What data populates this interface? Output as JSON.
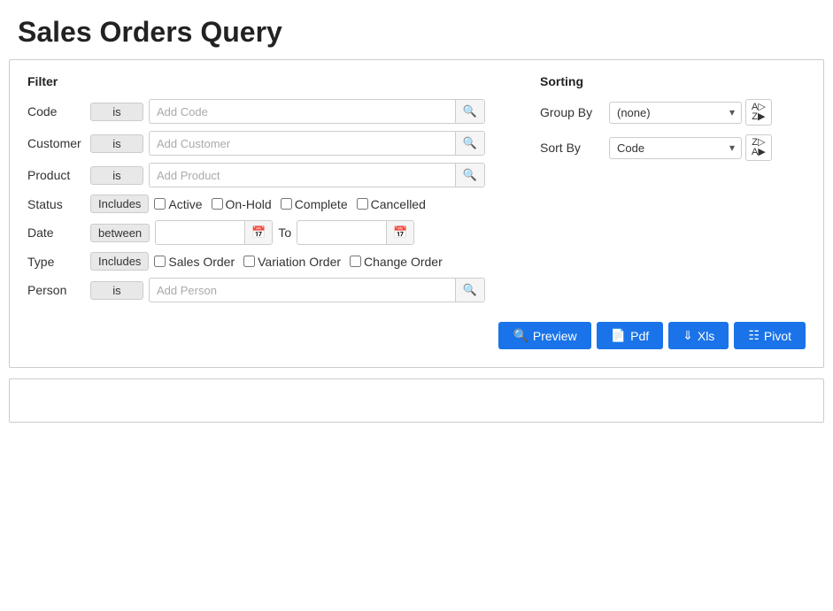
{
  "page": {
    "title": "Sales Orders Query"
  },
  "filter": {
    "heading": "Filter",
    "rows": [
      {
        "label": "Code",
        "badge": "is",
        "input_placeholder": "Add Code",
        "type": "text"
      },
      {
        "label": "Customer",
        "badge": "is",
        "input_placeholder": "Add Customer",
        "type": "text"
      },
      {
        "label": "Product",
        "badge": "is",
        "input_placeholder": "Add Product",
        "type": "text"
      }
    ],
    "status": {
      "label": "Status",
      "badge": "Includes",
      "options": [
        "Active",
        "On-Hold",
        "Complete",
        "Cancelled"
      ]
    },
    "date": {
      "label": "Date",
      "badge": "between",
      "to_label": "To"
    },
    "type": {
      "label": "Type",
      "badge": "Includes",
      "options": [
        "Sales Order",
        "Variation Order",
        "Change Order"
      ]
    },
    "person": {
      "label": "Person",
      "badge": "is",
      "input_placeholder": "Add Person"
    }
  },
  "sorting": {
    "heading": "Sorting",
    "group_by": {
      "label": "Group By",
      "selected": "(none)",
      "options": [
        "(none)"
      ]
    },
    "sort_by": {
      "label": "Sort By",
      "selected": "Code",
      "options": [
        "Code"
      ]
    }
  },
  "actions": {
    "preview": "Preview",
    "pdf": "Pdf",
    "xls": "Xls",
    "pivot": "Pivot"
  }
}
